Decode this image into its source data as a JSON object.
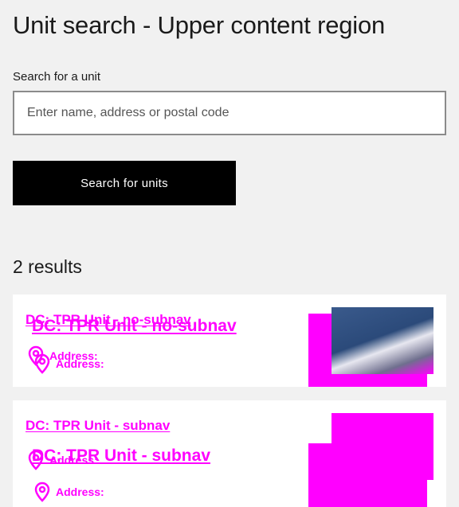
{
  "page": {
    "title": "Unit search - Upper content region"
  },
  "search": {
    "label": "Search for a unit",
    "placeholder": "Enter name, address or postal code",
    "value": "",
    "button_label": "Search for units"
  },
  "results": {
    "count_text": "2 results",
    "items": [
      {
        "title": "DC: TPR Unit - no-subnav",
        "address_label": "Address:"
      },
      {
        "title": "DC: TPR Unit - subnav",
        "address_label": "Address:"
      }
    ]
  },
  "colors": {
    "accent": "#ff00ff",
    "button_bg": "#000000",
    "page_bg": "#f1f1f1",
    "card_bg": "#ffffff"
  },
  "icons": {
    "address": "map-pin-icon"
  }
}
